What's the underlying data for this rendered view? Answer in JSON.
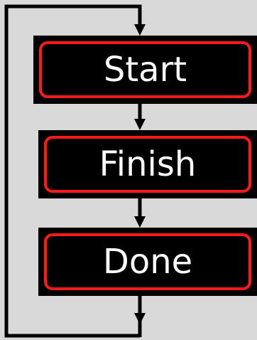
{
  "steps": [
    {
      "id": "start",
      "label": "Start"
    },
    {
      "id": "finish",
      "label": "Finish"
    },
    {
      "id": "done",
      "label": "Done"
    }
  ],
  "colors": {
    "background": "#d9d9d9",
    "box_fill": "#000000",
    "box_border": "#ff1a1a",
    "text": "#ffffff",
    "connector": "#000000"
  }
}
